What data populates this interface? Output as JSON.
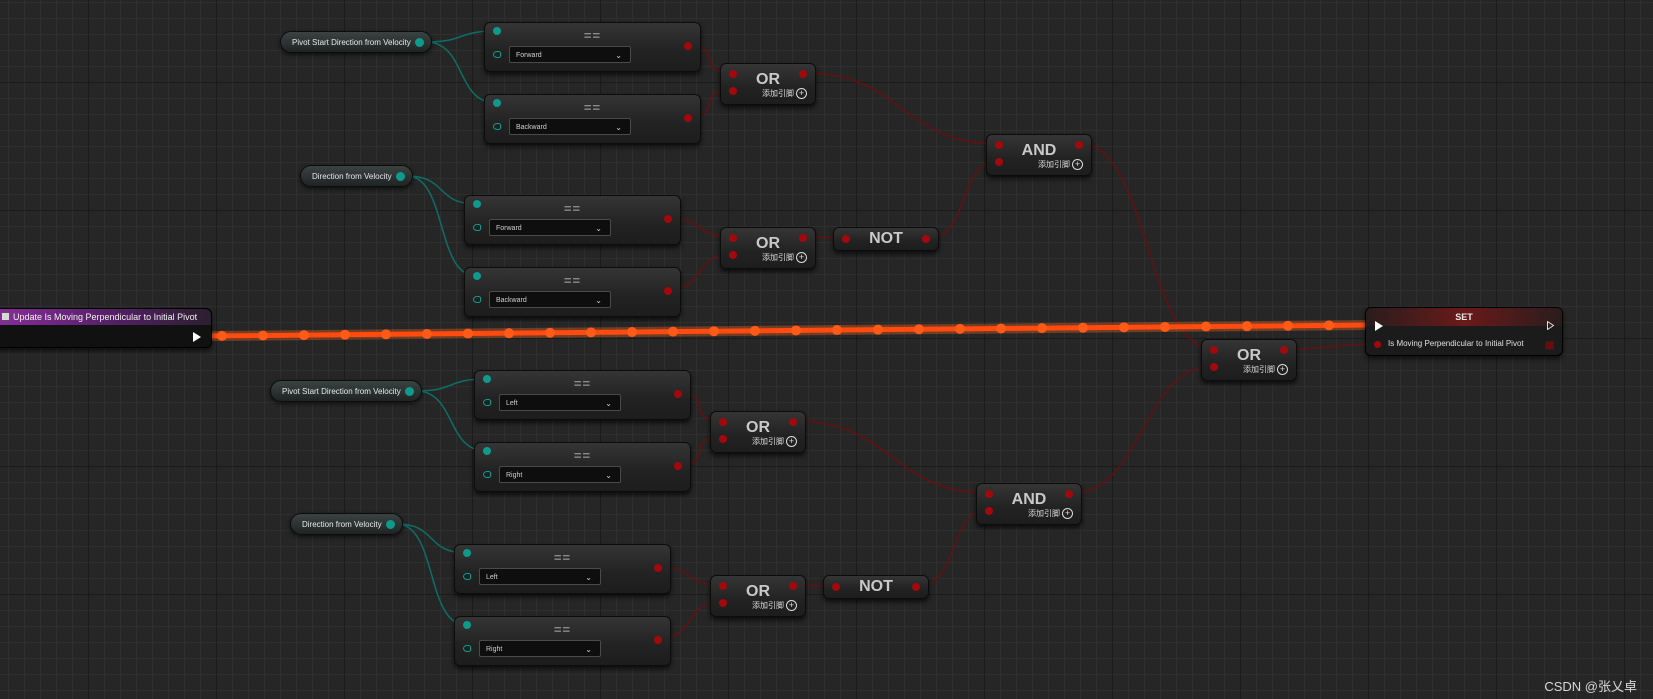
{
  "event": {
    "label": "Update Is Moving Perpendicular to Initial Pivot"
  },
  "getters": {
    "pivot_start_1": "Pivot Start Direction from Velocity",
    "direction_1": "Direction from Velocity",
    "pivot_start_2": "Pivot Start Direction from Velocity",
    "direction_2": "Direction from Velocity"
  },
  "eq_title": "==",
  "enums": {
    "a1": "Forward",
    "a2": "Backward",
    "b1": "Forward",
    "b2": "Backward",
    "c1": "Left",
    "c2": "Right",
    "d1": "Left",
    "d2": "Right"
  },
  "logic": {
    "or": "OR",
    "and": "AND",
    "not": "NOT",
    "add_pin": "添加引脚"
  },
  "set_node": {
    "title": "SET",
    "pin_label": "Is Moving Perpendicular to Initial Pivot"
  },
  "watermark": "CSDN @张乂卓",
  "colors": {
    "exec_wire": "#ff4a10",
    "bool_wire": "#6e0d0d",
    "enum_wire": "#0e6e66",
    "bool_pin": "#a3080d",
    "enum_pin": "#0f9a8e",
    "event_header": "#8b2d9e",
    "set_header": "#6a1a1a"
  },
  "icons": {
    "plus": "+",
    "chevron": "⌄"
  }
}
